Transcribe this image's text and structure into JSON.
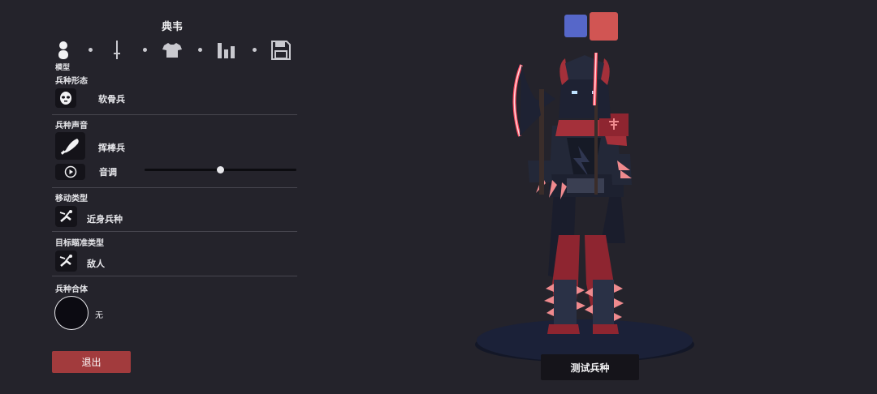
{
  "unit": {
    "name": "典韦"
  },
  "tabs": {
    "items": [
      {
        "icon": "person-icon",
        "label": "模型"
      },
      {
        "icon": "sword-icon"
      },
      {
        "icon": "shirt-icon"
      },
      {
        "icon": "stats-icon"
      },
      {
        "icon": "save-icon"
      }
    ],
    "active_label": "模型"
  },
  "sections": {
    "form": {
      "label": "兵种形态",
      "value": "软骨兵"
    },
    "sound": {
      "label": "兵种声音",
      "value": "挥棒兵",
      "pitch_label": "音调",
      "pitch_level": 0.5
    },
    "move": {
      "label": "移动类型",
      "value": "近身兵种"
    },
    "target": {
      "label": "目标瞄准类型",
      "value": "敌人"
    },
    "combine": {
      "label": "兵种合体",
      "value": "无"
    }
  },
  "buttons": {
    "exit": "退出",
    "test": "测试兵种"
  },
  "team_colors": {
    "blue": "#5667c9",
    "red": "#d15553"
  }
}
